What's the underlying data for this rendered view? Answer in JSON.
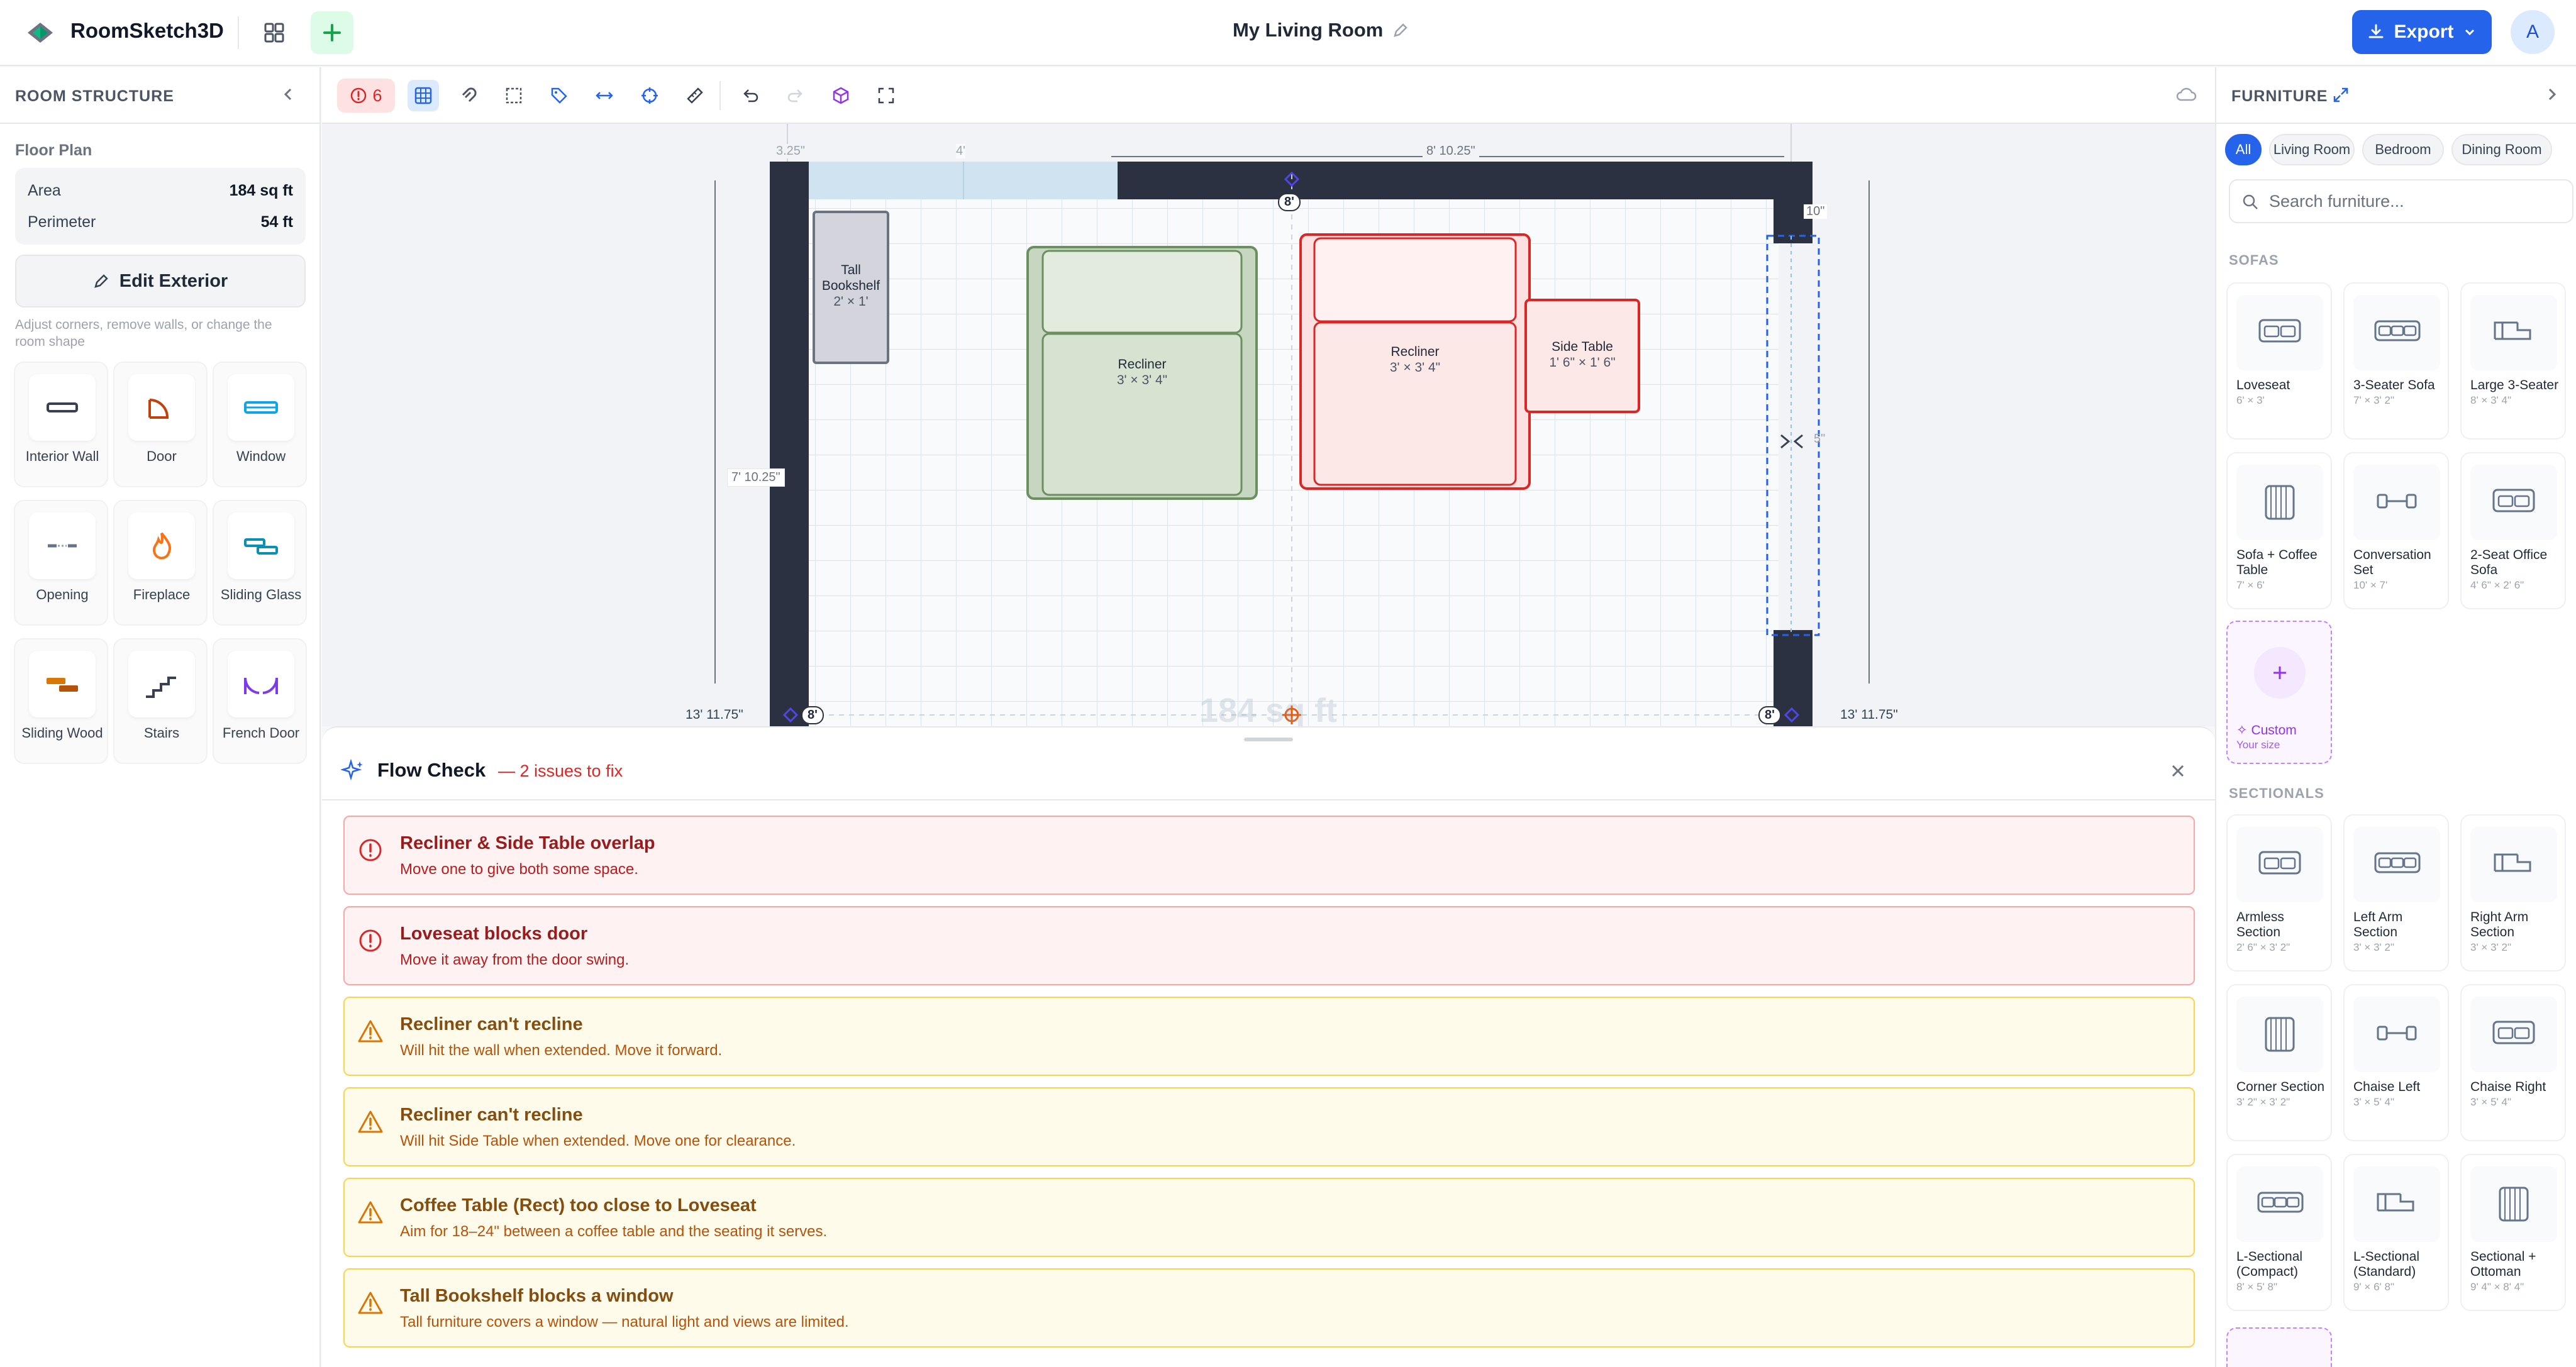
{
  "app": {
    "name": "RoomSketch3D",
    "title": "My Living Room",
    "export_label": "Export",
    "avatar_initial": "A"
  },
  "left": {
    "section_title": "ROOM STRUCTURE",
    "floor_plan_label": "Floor Plan",
    "area_label": "Area",
    "area_value": "184 sq ft",
    "perimeter_label": "Perimeter",
    "perimeter_value": "54 ft",
    "edit_label": "Edit Exterior",
    "helper": "Adjust corners, remove walls, or change the room shape",
    "tools": [
      {
        "label": "Interior Wall",
        "icon": "interior-wall-icon"
      },
      {
        "label": "Door",
        "icon": "door-icon"
      },
      {
        "label": "Window",
        "icon": "window-icon"
      },
      {
        "label": "Opening",
        "icon": "opening-icon"
      },
      {
        "label": "Fireplace",
        "icon": "fireplace-icon"
      },
      {
        "label": "Sliding Glass",
        "icon": "sliding-glass-icon"
      },
      {
        "label": "Sliding Wood",
        "icon": "sliding-wood-icon"
      },
      {
        "label": "Stairs",
        "icon": "stairs-icon"
      },
      {
        "label": "French Door",
        "icon": "french-door-icon"
      }
    ]
  },
  "toolbar": {
    "issue_count": "6"
  },
  "canvas": {
    "dims": {
      "top_left": "3.25\"",
      "top_mid": "4'",
      "top_right": "8' 10.25\"",
      "left_side": "7' 10.25\"",
      "outer_left": "13' 11.75\"",
      "outer_right": "13' 11.75\"",
      "right_gap": "10\"",
      "corner_a": "8'",
      "corner_b": "8'",
      "corner_c": "8'",
      "right_small": "5\""
    },
    "area_watermark": "184 sq ft",
    "items": [
      {
        "name": "Tall Bookshelf",
        "size": "2' × 1'"
      },
      {
        "name": "Recliner",
        "size": "3' × 3' 4\""
      },
      {
        "name": "Recliner",
        "size": "3' × 3' 4\""
      },
      {
        "name": "Side Table",
        "size": "1' 6\" × 1' 6\""
      }
    ]
  },
  "flow": {
    "title": "Flow Check",
    "subtitle": "— 2 issues to fix",
    "issues": [
      {
        "kind": "error",
        "title": "Recliner & Side Table overlap",
        "desc": "Move one to give both some space."
      },
      {
        "kind": "error",
        "title": "Loveseat blocks door",
        "desc": "Move it away from the door swing."
      },
      {
        "kind": "warning",
        "title": "Recliner can't recline",
        "desc": "Will hit the wall when extended. Move it forward."
      },
      {
        "kind": "warning",
        "title": "Recliner can't recline",
        "desc": "Will hit Side Table when extended. Move one for clearance."
      },
      {
        "kind": "warning",
        "title": "Coffee Table (Rect) too close to Loveseat",
        "desc": "Aim for 18–24\" between a coffee table and the seating it serves."
      },
      {
        "kind": "warning",
        "title": "Tall Bookshelf blocks a window",
        "desc": "Tall furniture covers a window — natural light and views are limited."
      }
    ]
  },
  "right": {
    "title": "FURNITURE",
    "chips": [
      "All",
      "Living Room",
      "Bedroom",
      "Dining Room"
    ],
    "search_placeholder": "Search furniture...",
    "sofas_label": "SOFAS",
    "sofas": [
      {
        "name": "Loveseat",
        "dims": "6' × 3'"
      },
      {
        "name": "3-Seater Sofa",
        "dims": "7' × 3' 2\""
      },
      {
        "name": "Large 3-Seater",
        "dims": "8' × 3' 4\""
      },
      {
        "name": "Sofa + Coffee Table",
        "dims": "7' × 6'"
      },
      {
        "name": "Conversation Set",
        "dims": "10' × 7'"
      },
      {
        "name": "2-Seat Office Sofa",
        "dims": "4' 6\" × 2' 6\""
      }
    ],
    "custom_label": "Custom",
    "custom_sub": "Your size",
    "sectionals_label": "SECTIONALS",
    "sectionals": [
      {
        "name": "Armless Section",
        "dims": "2' 6\" × 3' 2\""
      },
      {
        "name": "Left Arm Section",
        "dims": "3' × 3' 2\""
      },
      {
        "name": "Right Arm Section",
        "dims": "3' × 3' 2\""
      },
      {
        "name": "Corner Section",
        "dims": "3' 2\" × 3' 2\""
      },
      {
        "name": "Chaise Left",
        "dims": "3' × 5' 4\""
      },
      {
        "name": "Chaise Right",
        "dims": "3' × 5' 4\""
      },
      {
        "name": "L-Sectional (Compact)",
        "dims": "8' × 5' 8\""
      },
      {
        "name": "L-Sectional (Standard)",
        "dims": "9' × 6' 8\""
      },
      {
        "name": "Sectional + Ottoman",
        "dims": "9' 4\" × 8' 4\""
      }
    ]
  }
}
